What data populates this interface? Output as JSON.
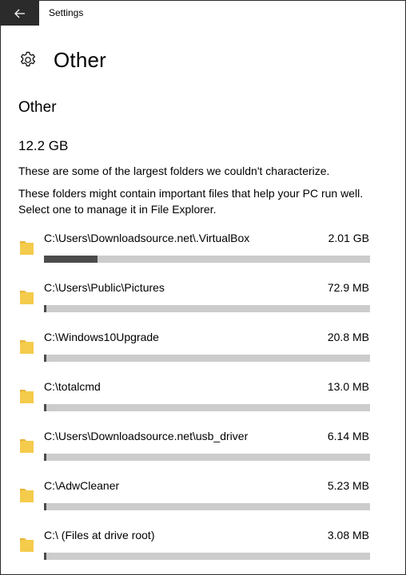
{
  "app": {
    "title": "Settings"
  },
  "header": {
    "title": "Other",
    "icon": "gear-icon"
  },
  "section": {
    "title": "Other",
    "total_size": "12.2 GB",
    "desc1": "These are some of the largest folders we couldn't characterize.",
    "desc2": "These folders might contain important files that help your PC run well. Select one to manage it in File Explorer."
  },
  "colors": {
    "titlebar_back": "#2b2b2b",
    "bar_track": "#cccccc",
    "bar_fill": "#4c4c4c",
    "folder_yellow": "#f4cb4b"
  },
  "folders": [
    {
      "path": "C:\\Users\\Downloadsource.net\\.VirtualBox",
      "size": "2.01 GB",
      "usage_fraction": 0.165
    },
    {
      "path": "C:\\Users\\Public\\Pictures",
      "size": "72.9 MB",
      "usage_fraction": 0.006
    },
    {
      "path": "C:\\Windows10Upgrade",
      "size": "20.8 MB",
      "usage_fraction": 0.002
    },
    {
      "path": "C:\\totalcmd",
      "size": "13.0 MB",
      "usage_fraction": 0.001
    },
    {
      "path": "C:\\Users\\Downloadsource.net\\usb_driver",
      "size": "6.14 MB",
      "usage_fraction": 0.001
    },
    {
      "path": "C:\\AdwCleaner",
      "size": "5.23 MB",
      "usage_fraction": 0.001
    },
    {
      "path": "C:\\ (Files at drive root)",
      "size": "3.08 MB",
      "usage_fraction": 0.001
    }
  ]
}
